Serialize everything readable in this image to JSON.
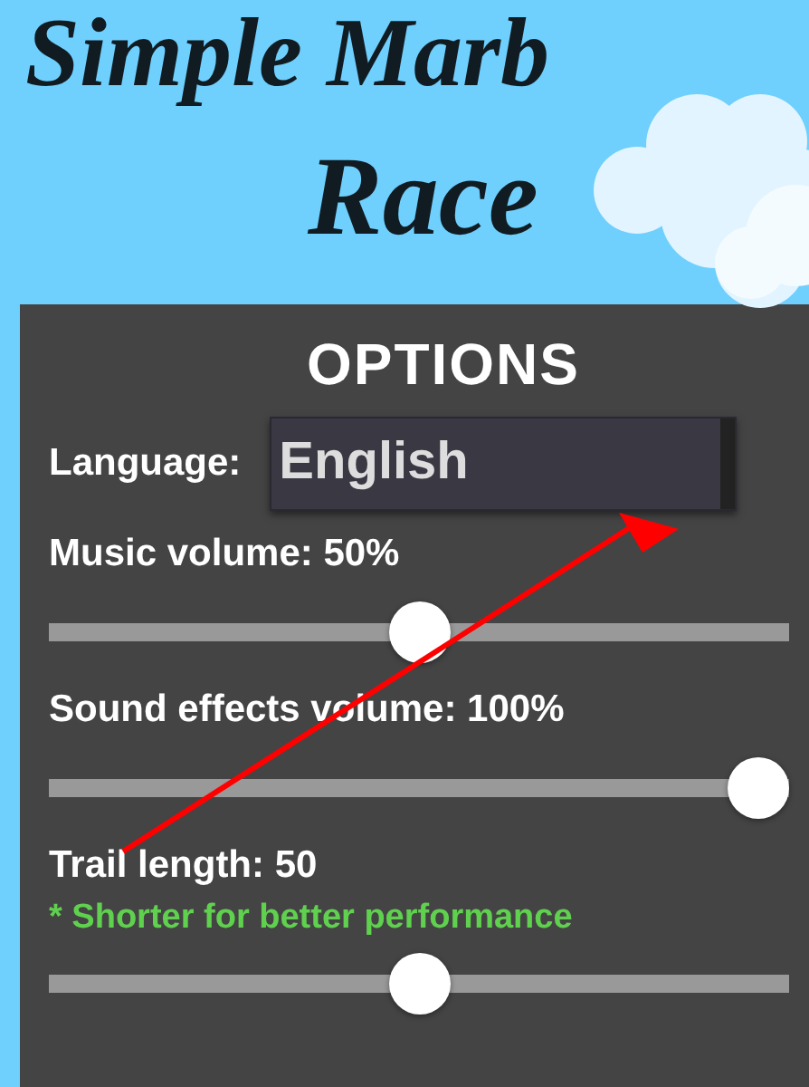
{
  "game_title": [
    "Simple Marb",
    "Race"
  ],
  "options": {
    "heading": "OPTIONS",
    "language": {
      "label": "Language:",
      "value": "English"
    },
    "sliders": [
      {
        "label": "Music volume: 50%",
        "level": 0.5
      },
      {
        "label": "Sound effects volume: 100%",
        "level": 1.0
      },
      {
        "label": "Trail length: 50",
        "hint": "* Shorter for better performance",
        "level": 0.5
      }
    ]
  },
  "annotation": {
    "kind": "arrow"
  }
}
